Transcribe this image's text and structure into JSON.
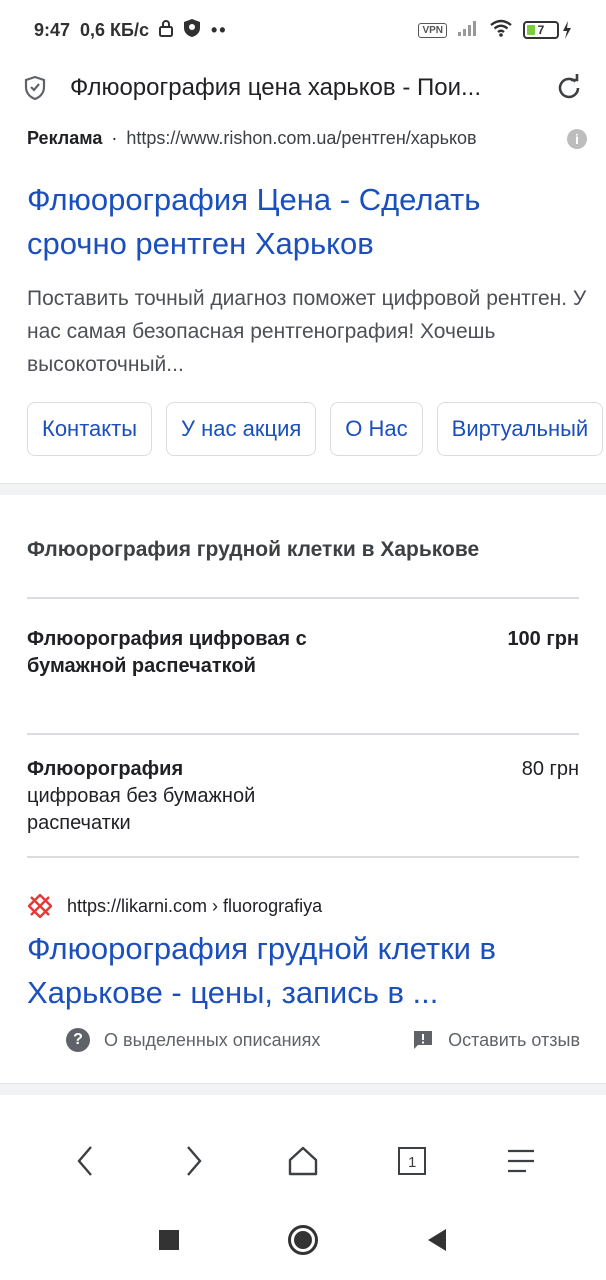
{
  "status_bar": {
    "time": "9:47",
    "speed": "0,6 КБ/с",
    "vpn": "VPN",
    "battery": "7"
  },
  "url_bar": {
    "title": "Флюорография цена харьков - Пои..."
  },
  "ad": {
    "label": "Реклама",
    "dot": "·",
    "url": "https://www.rishon.com.ua/рентген/харьков",
    "title": "Флюорография Цена - Сделать срочно рентген Харьков",
    "description": "Поставить точный диагноз поможет цифровой рентген. У нас самая безопасная рентгенография! Хочешь высокоточный...",
    "sitelinks": [
      "Контакты",
      "У нас акция",
      "О Нас",
      "Виртуальный"
    ]
  },
  "price_card": {
    "title": "Флюорография грудной клетки в Харькове",
    "rows": [
      {
        "name": "Флюорография цифровая с бумажной распечаткой",
        "price": "100 грн"
      },
      {
        "name_bold": "Флюорография",
        "name_rest": "цифровая без бумажной распечатки",
        "price": "80 грн"
      }
    ]
  },
  "organic": {
    "url": "https://likarni.com › fluorografiya",
    "title": "Флюорография грудной клетки в Харькове - цены, запись в ..."
  },
  "feedback": {
    "about": "О выделенных описаниях",
    "leave": "Оставить отзыв"
  },
  "browser_nav": {
    "tab_count": "1"
  },
  "colors": {
    "link": "#1a4fbd",
    "battery": "#7ccd3c"
  }
}
